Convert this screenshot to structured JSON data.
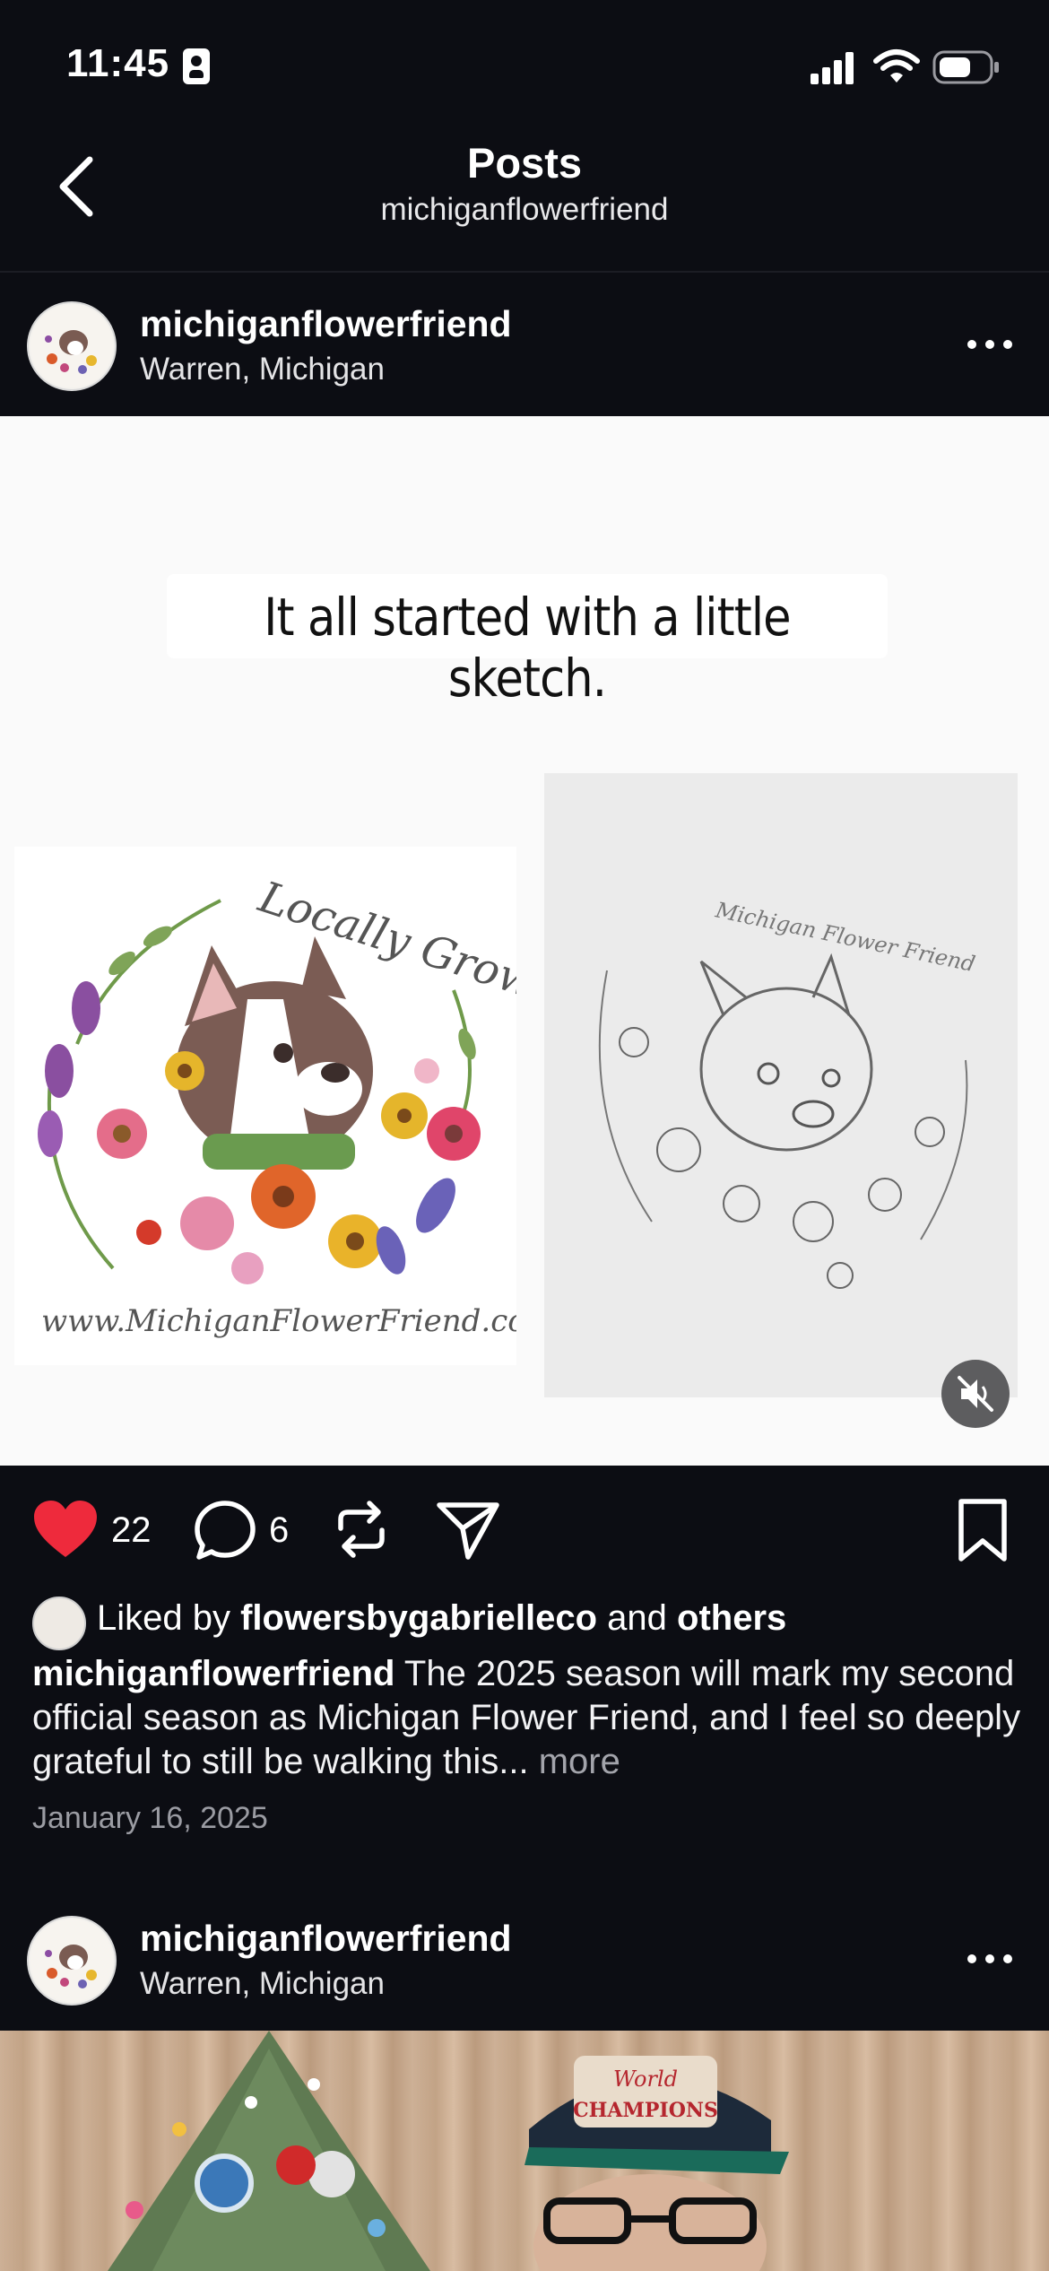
{
  "status_bar": {
    "time": "11:45"
  },
  "header": {
    "title": "Posts",
    "subtitle": "michiganflowerfriend"
  },
  "post1": {
    "username": "michiganflowerfriend",
    "location": "Warren, Michigan",
    "image": {
      "caption_overlay": "It all started with a little sketch.",
      "logo_text_top": "Locally Grown",
      "logo_text_bottom": "www.MichiganFlowerFriend.com",
      "sketch_text": "Michigan Flower Friend"
    },
    "actions": {
      "likes": "22",
      "comments": "6"
    },
    "liked_by": {
      "prefix": "Liked by",
      "user": "flowersbygabrielleco",
      "conjunction": "and",
      "others": "others"
    },
    "caption": {
      "author": "michiganflowerfriend",
      "text": "The 2025 season will mark my second official season as Michigan Flower Friend, and I feel so deeply grateful to still be walking this...",
      "more": "more"
    },
    "date": "January 16, 2025"
  },
  "post2": {
    "username": "michiganflowerfriend",
    "location": "Warren, Michigan",
    "image_hat_text": "World Series CHAMPIONS"
  },
  "colors": {
    "background": "#0c0d13",
    "like_red": "#ee2a3c",
    "muted_text": "#9b9ca3"
  },
  "icons": [
    "back-icon",
    "more-icon",
    "heart-icon",
    "comment-icon",
    "repost-icon",
    "share-icon",
    "bookmark-icon",
    "mute-icon",
    "signal-icon",
    "wifi-icon",
    "battery-icon"
  ]
}
